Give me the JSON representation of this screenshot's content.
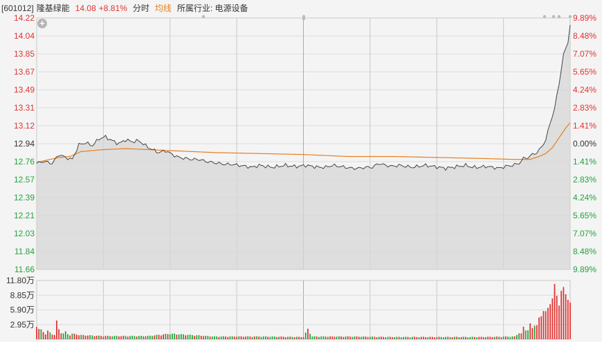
{
  "header": {
    "code": "[601012]",
    "name": "隆基绿能",
    "price": "14.08",
    "change": "+8.81%",
    "time_share_label": "分时",
    "avg_line_label": "均线",
    "industry": "所属行业: 电源设备"
  },
  "colors": {
    "up": "#e03333",
    "down": "#22a33c",
    "neutral": "#333333",
    "price_line": "#444444",
    "avg_line": "#e87d1e",
    "grid": "#c8c8c8",
    "area": "#d7d7d7"
  },
  "icons": {
    "zoom": "plus-circle-icon"
  },
  "chart_data": [
    {
      "type": "line",
      "title": "",
      "ylim": [
        11.66,
        14.22
      ],
      "y_ticks": [
        {
          "label": "14.22",
          "pct": "9.89%",
          "dir": "up"
        },
        {
          "label": "14.04",
          "pct": "8.48%",
          "dir": "up"
        },
        {
          "label": "13.85",
          "pct": "7.07%",
          "dir": "up"
        },
        {
          "label": "13.67",
          "pct": "5.65%",
          "dir": "up"
        },
        {
          "label": "13.49",
          "pct": "4.24%",
          "dir": "up"
        },
        {
          "label": "13.31",
          "pct": "2.83%",
          "dir": "up"
        },
        {
          "label": "13.12",
          "pct": "1.41%",
          "dir": "up"
        },
        {
          "label": "12.94",
          "pct": "0.00%",
          "dir": "flat"
        },
        {
          "label": "12.76",
          "pct": "1.41%",
          "dir": "down"
        },
        {
          "label": "12.57",
          "pct": "2.83%",
          "dir": "down"
        },
        {
          "label": "12.39",
          "pct": "4.24%",
          "dir": "down"
        },
        {
          "label": "12.21",
          "pct": "5.65%",
          "dir": "down"
        },
        {
          "label": "12.03",
          "pct": "7.07%",
          "dir": "down"
        },
        {
          "label": "11.84",
          "pct": "8.48%",
          "dir": "down"
        },
        {
          "label": "11.66",
          "pct": "9.89%",
          "dir": "down"
        }
      ],
      "grid": true,
      "n_minutes": 241,
      "price_keypoints": [
        [
          0,
          12.74
        ],
        [
          3,
          12.76
        ],
        [
          7,
          12.74
        ],
        [
          10,
          12.83
        ],
        [
          13,
          12.8
        ],
        [
          16,
          12.78
        ],
        [
          19,
          12.93
        ],
        [
          22,
          12.95
        ],
        [
          25,
          12.92
        ],
        [
          28,
          12.99
        ],
        [
          31,
          13.01
        ],
        [
          34,
          12.97
        ],
        [
          37,
          12.94
        ],
        [
          40,
          12.98
        ],
        [
          43,
          12.96
        ],
        [
          46,
          12.97
        ],
        [
          49,
          12.92
        ],
        [
          52,
          12.88
        ],
        [
          55,
          12.85
        ],
        [
          58,
          12.87
        ],
        [
          61,
          12.83
        ],
        [
          64,
          12.8
        ],
        [
          67,
          12.79
        ],
        [
          70,
          12.78
        ],
        [
          73,
          12.78
        ],
        [
          76,
          12.76
        ],
        [
          79,
          12.75
        ],
        [
          82,
          12.74
        ],
        [
          85,
          12.73
        ],
        [
          88,
          12.73
        ],
        [
          91,
          12.72
        ],
        [
          94,
          12.71
        ],
        [
          97,
          12.7
        ],
        [
          100,
          12.72
        ],
        [
          103,
          12.71
        ],
        [
          106,
          12.7
        ],
        [
          109,
          12.71
        ],
        [
          112,
          12.72
        ],
        [
          115,
          12.71
        ],
        [
          118,
          12.71
        ],
        [
          121,
          12.72
        ],
        [
          124,
          12.71
        ],
        [
          127,
          12.7
        ],
        [
          130,
          12.7
        ],
        [
          133,
          12.72
        ],
        [
          136,
          12.71
        ],
        [
          139,
          12.7
        ],
        [
          142,
          12.69
        ],
        [
          145,
          12.69
        ],
        [
          148,
          12.7
        ],
        [
          151,
          12.7
        ],
        [
          154,
          12.74
        ],
        [
          157,
          12.72
        ],
        [
          160,
          12.71
        ],
        [
          163,
          12.72
        ],
        [
          166,
          12.71
        ],
        [
          169,
          12.7
        ],
        [
          172,
          12.71
        ],
        [
          175,
          12.72
        ],
        [
          178,
          12.71
        ],
        [
          181,
          12.7
        ],
        [
          184,
          12.69
        ],
        [
          187,
          12.7
        ],
        [
          190,
          12.71
        ],
        [
          193,
          12.72
        ],
        [
          196,
          12.7
        ],
        [
          199,
          12.7
        ],
        [
          202,
          12.71
        ],
        [
          205,
          12.7
        ],
        [
          208,
          12.69
        ],
        [
          211,
          12.71
        ],
        [
          214,
          12.72
        ],
        [
          217,
          12.74
        ],
        [
          219,
          12.79
        ],
        [
          221,
          12.8
        ],
        [
          223,
          12.83
        ],
        [
          225,
          12.85
        ],
        [
          227,
          12.9
        ],
        [
          229,
          12.98
        ],
        [
          231,
          13.15
        ],
        [
          233,
          13.3
        ],
        [
          235,
          13.55
        ],
        [
          236,
          13.7
        ],
        [
          237,
          13.85
        ],
        [
          238,
          13.9
        ],
        [
          239,
          13.98
        ],
        [
          240,
          14.15
        ],
        [
          241,
          14.1
        ],
        [
          242,
          14.08
        ],
        [
          243,
          14.15
        ],
        [
          244,
          14.07
        ],
        [
          245,
          14.06
        ],
        [
          246,
          14.07
        ]
      ],
      "avg_keypoints": [
        [
          0,
          12.75
        ],
        [
          10,
          12.8
        ],
        [
          15,
          12.81
        ],
        [
          20,
          12.86
        ],
        [
          30,
          12.88
        ],
        [
          40,
          12.89
        ],
        [
          50,
          12.88
        ],
        [
          60,
          12.87
        ],
        [
          70,
          12.86
        ],
        [
          80,
          12.85
        ],
        [
          100,
          12.84
        ],
        [
          120,
          12.83
        ],
        [
          140,
          12.81
        ],
        [
          160,
          12.81
        ],
        [
          180,
          12.8
        ],
        [
          200,
          12.79
        ],
        [
          215,
          12.78
        ],
        [
          222,
          12.78
        ],
        [
          226,
          12.81
        ],
        [
          229,
          12.84
        ],
        [
          232,
          12.9
        ],
        [
          235,
          13.0
        ],
        [
          238,
          13.1
        ],
        [
          241,
          13.18
        ],
        [
          243,
          13.25
        ],
        [
          245,
          13.3
        ],
        [
          246,
          13.3
        ]
      ]
    },
    {
      "type": "bar",
      "title": "",
      "unit": "万",
      "ylim": [
        0,
        11.8
      ],
      "y_ticks": [
        "11.80万",
        "8.85万",
        "5.90万",
        "2.95万"
      ],
      "volume_keypoints": [
        [
          0,
          3.3
        ],
        [
          1,
          2.2
        ],
        [
          2,
          2.0
        ],
        [
          3,
          1.6
        ],
        [
          4,
          1.2
        ],
        [
          5,
          1.8
        ],
        [
          6,
          1.4
        ],
        [
          7,
          1.1
        ],
        [
          8,
          1.0
        ],
        [
          9,
          3.8
        ],
        [
          10,
          2.1
        ],
        [
          11,
          1.5
        ],
        [
          12,
          1.3
        ],
        [
          13,
          1.6
        ],
        [
          14,
          1.1
        ],
        [
          15,
          1.0
        ],
        [
          16,
          1.2
        ],
        [
          20,
          0.9
        ],
        [
          30,
          0.7
        ],
        [
          50,
          0.7
        ],
        [
          60,
          1.2
        ],
        [
          80,
          0.6
        ],
        [
          100,
          0.6
        ],
        [
          120,
          0.5
        ],
        [
          122,
          2.2
        ],
        [
          124,
          0.6
        ],
        [
          140,
          0.6
        ],
        [
          160,
          0.5
        ],
        [
          180,
          0.5
        ],
        [
          200,
          0.5
        ],
        [
          215,
          0.6
        ],
        [
          217,
          1.4
        ],
        [
          218,
          1.2
        ],
        [
          219,
          2.6
        ],
        [
          220,
          2.2
        ],
        [
          221,
          2.0
        ],
        [
          222,
          3.2
        ],
        [
          223,
          2.4
        ],
        [
          224,
          3.6
        ],
        [
          225,
          3.0
        ],
        [
          226,
          4.4
        ],
        [
          227,
          5.2
        ],
        [
          228,
          7.0
        ],
        [
          229,
          5.8
        ],
        [
          230,
          6.4
        ],
        [
          231,
          8.4
        ],
        [
          232,
          9.5
        ],
        [
          233,
          11.2
        ],
        [
          234,
          9.1
        ],
        [
          235,
          8.6
        ],
        [
          236,
          10.7
        ],
        [
          237,
          10.5
        ],
        [
          238,
          9.8
        ],
        [
          239,
          10.3
        ],
        [
          240,
          7.8
        ],
        [
          241,
          6.9
        ],
        [
          242,
          10.2
        ],
        [
          243,
          9.1
        ],
        [
          244,
          5.0
        ],
        [
          245,
          4.6
        ],
        [
          246,
          6.9
        ]
      ]
    }
  ]
}
